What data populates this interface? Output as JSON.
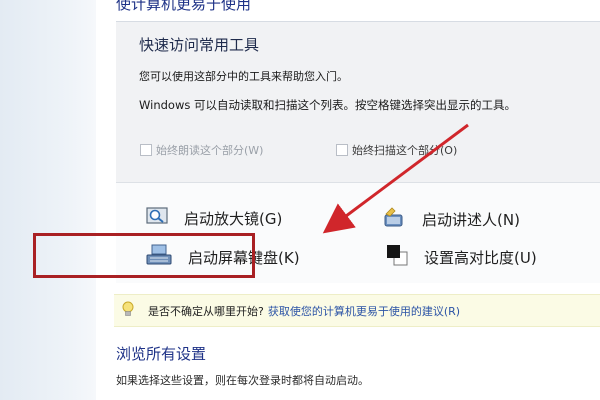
{
  "page": {
    "heading": "使计算机更易于使用"
  },
  "quick_access": {
    "title": "快速访问常用工具",
    "description": "您可以使用这部分中的工具来帮助您入门。",
    "note": "Windows 可以自动读取和扫描这个列表。按空格键选择突出显示的工具。",
    "checkbox_read": "始终朗读这个部分(W)",
    "checkbox_scan": "始终扫描这个部分(O)"
  },
  "tools": {
    "magnifier": "启动放大镜(G)",
    "narrator": "启动讲述人(N)",
    "onscreen_keyboard": "启动屏幕键盘(K)",
    "high_contrast": "设置高对比度(U)"
  },
  "tip": {
    "text": "是否不确定从哪里开始?",
    "link": "获取使您的计算机更易于使用的建议(R)"
  },
  "browse": {
    "title": "浏览所有设置",
    "description": "如果选择这些设置，则在每次登录时都将自动启动。"
  },
  "colors": {
    "annotation": "#d0262b",
    "link": "#2c54a6",
    "heading": "#1e3287"
  },
  "icons": {
    "magnifier": "magnifier-icon",
    "narrator": "narrator-icon",
    "keyboard": "keyboard-icon",
    "contrast": "high-contrast-icon",
    "tip": "lightbulb-icon"
  }
}
